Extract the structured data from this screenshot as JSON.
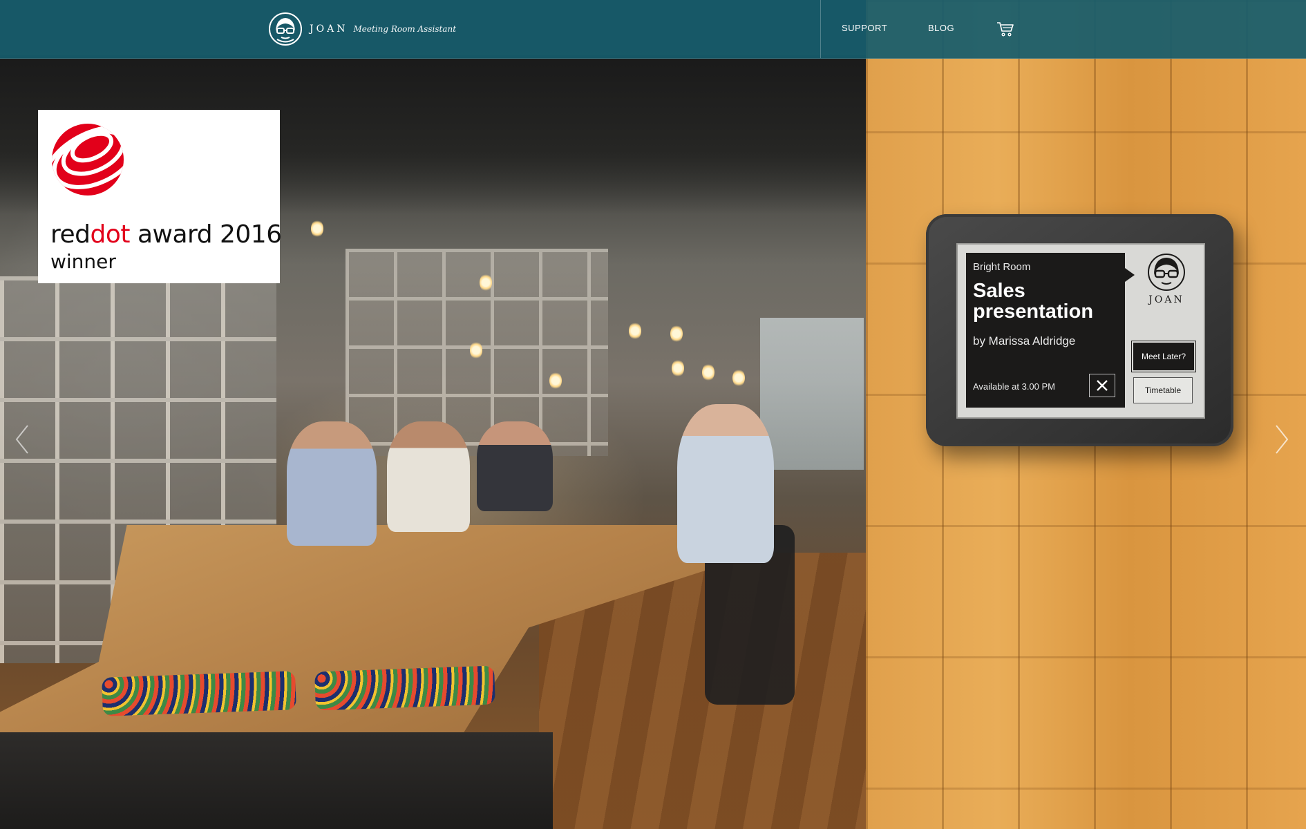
{
  "header": {
    "logo_word": "JOAN",
    "logo_tagline": "Meeting Room Assistant",
    "nav": [
      {
        "label": "SUPPORT"
      },
      {
        "label": "BLOG"
      }
    ],
    "cart_icon": "shopping-cart-icon"
  },
  "award": {
    "prefix": "red",
    "highlight": "dot",
    "suffix": " award 2016",
    "line2": "winner",
    "brand_color": "#e2001a"
  },
  "device": {
    "room_name": "Bright Room",
    "meeting_title": "Sales presentation",
    "organizer": "by Marissa Aldridge",
    "availability": "Available at 3.00 PM",
    "logo_word": "JOAN",
    "buttons": {
      "meet_later": "Meet Later?",
      "timetable": "Timetable"
    }
  },
  "colors": {
    "nav_background": "#165c6c",
    "nav_text": "#ffffff"
  }
}
